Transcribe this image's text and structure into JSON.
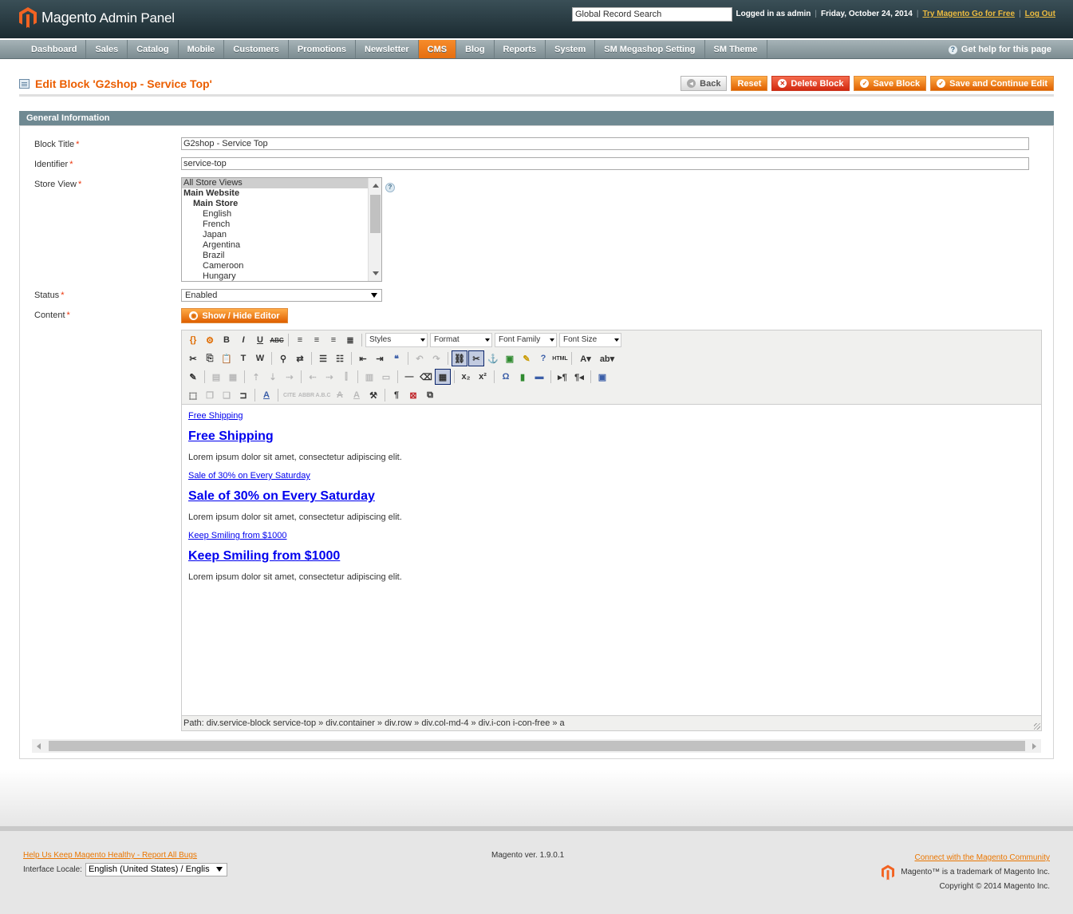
{
  "header": {
    "logo_brand": "Magento",
    "logo_sub": "Admin Panel",
    "search_value": "Global Record Search",
    "logged_in": "Logged in as admin",
    "date": "Friday, October 24, 2014",
    "try_link": "Try Magento Go for Free",
    "logout": "Log Out"
  },
  "nav": {
    "items": [
      "Dashboard",
      "Sales",
      "Catalog",
      "Mobile",
      "Customers",
      "Promotions",
      "Newsletter",
      "CMS",
      "Blog",
      "Reports",
      "System",
      "SM Megashop Setting",
      "SM Theme"
    ],
    "active": "CMS",
    "help": "Get help for this page"
  },
  "page": {
    "title": "Edit Block 'G2shop - Service Top'",
    "buttons": {
      "back": "Back",
      "reset": "Reset",
      "delete": "Delete Block",
      "save": "Save Block",
      "save_continue": "Save and Continue Edit"
    }
  },
  "form": {
    "section_title": "General Information",
    "block_title_label": "Block Title",
    "block_title_value": "G2shop - Service Top",
    "identifier_label": "Identifier",
    "identifier_value": "service-top",
    "store_view_label": "Store View",
    "store_view_options": [
      "All Store Views",
      "Main Website",
      "Main Store",
      "English",
      "French",
      "Japan",
      "Argentina",
      "Brazil",
      "Cameroon",
      "Hungary"
    ],
    "status_label": "Status",
    "status_value": "Enabled",
    "content_label": "Content",
    "required_mark": "*",
    "show_hide_editor": "Show / Hide Editor"
  },
  "editor": {
    "dropdowns": [
      "Styles",
      "Format",
      "Font Family",
      "Font Size"
    ],
    "content": [
      {
        "type": "link",
        "text": "Free Shipping"
      },
      {
        "type": "heading",
        "text": "Free Shipping"
      },
      {
        "type": "text",
        "text": "Lorem ipsum dolor sit amet, consectetur adipiscing elit."
      },
      {
        "type": "link",
        "text": "Sale of 30% on Every Saturday"
      },
      {
        "type": "heading",
        "text": "Sale of 30% on Every Saturday"
      },
      {
        "type": "text",
        "text": "Lorem ipsum dolor sit amet, consectetur adipiscing elit."
      },
      {
        "type": "link",
        "text": "Keep Smiling from $1000"
      },
      {
        "type": "heading",
        "text": "Keep Smiling from $1000"
      },
      {
        "type": "text",
        "text": "Lorem ipsum dolor sit amet, consectetur adipiscing elit."
      }
    ],
    "path": "Path: div.service-block service-top » div.container » div.row » div.col-md-4 » div.i-con i-con-free » a"
  },
  "footer": {
    "report_bugs": "Help Us Keep Magento Healthy - Report All Bugs",
    "locale_label": "Interface Locale:",
    "locale_value": "English (United States) / Englis",
    "version": "Magento ver. 1.9.0.1",
    "community": "Connect with the Magento Community",
    "trademark": "Magento™ is a trademark of Magento Inc.",
    "copyright": "Copyright © 2014 Magento Inc."
  },
  "colors": {
    "accent_orange": "#eb5e00",
    "header_dark": "#1b2b31",
    "section_head": "#6f8992",
    "link_blue": "#0000ee"
  }
}
